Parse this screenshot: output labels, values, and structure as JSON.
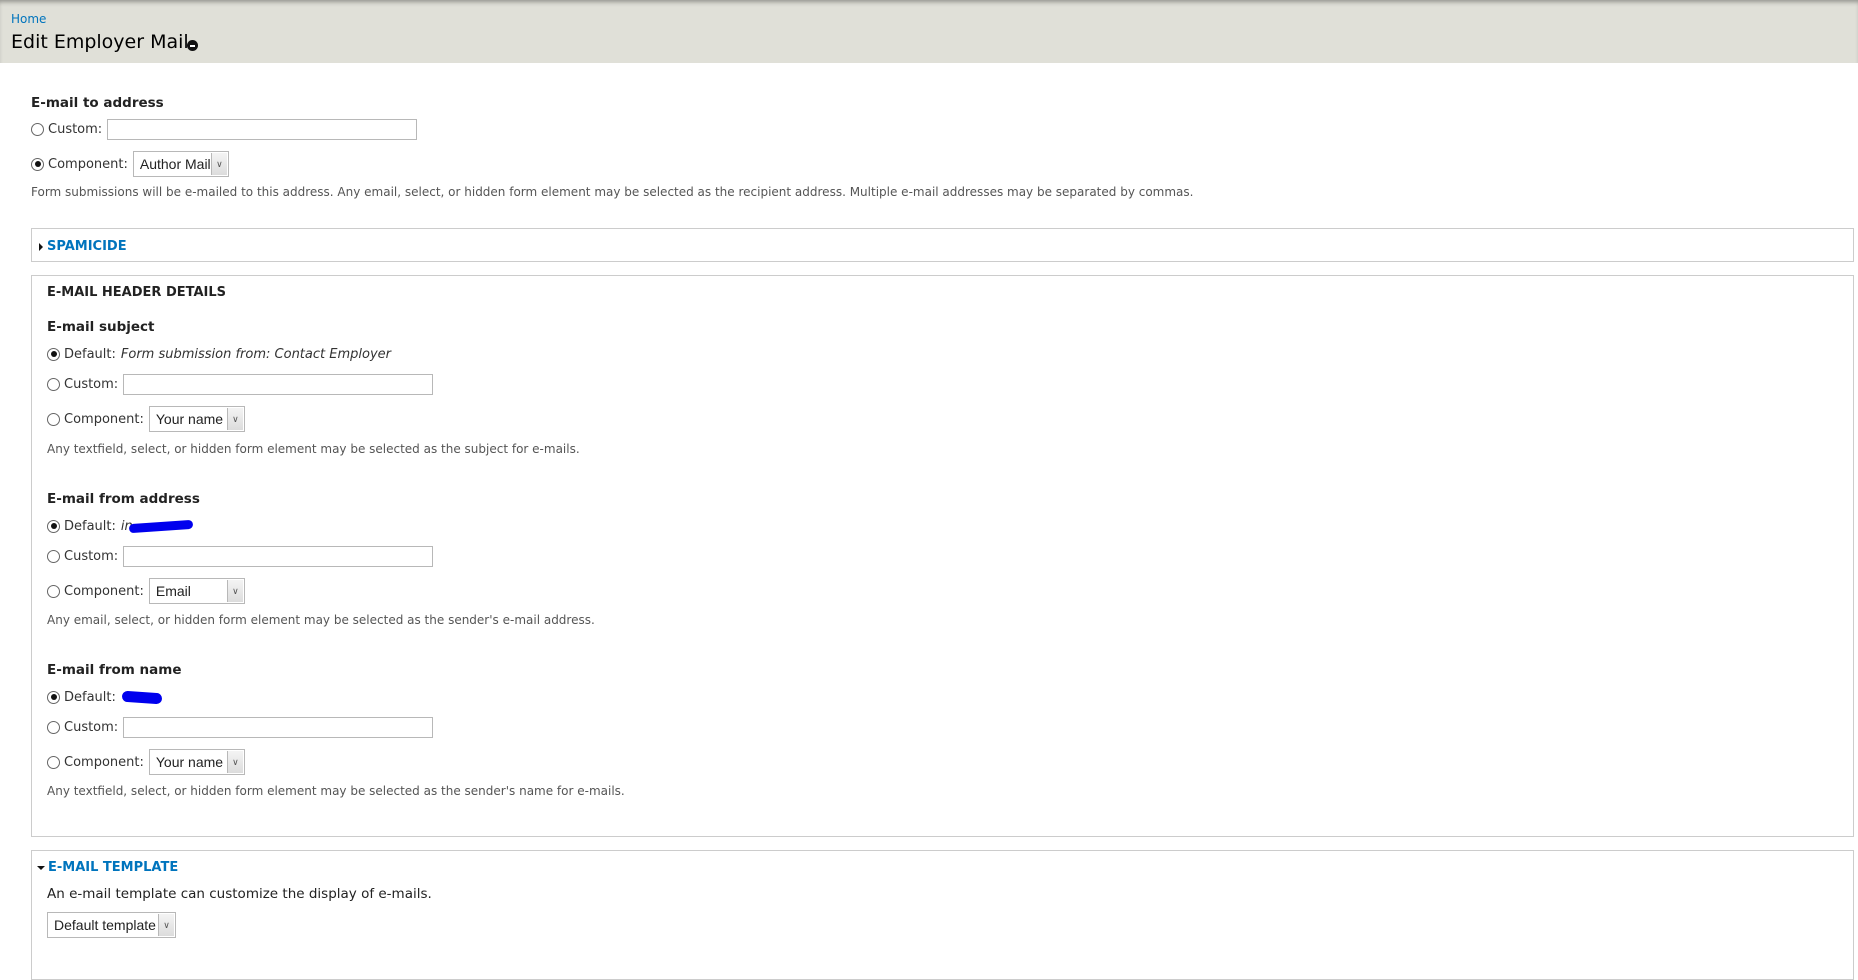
{
  "header": {
    "breadcrumb": "Home",
    "title": "Edit Employer Mail",
    "title_icon": "collapse-minus-icon"
  },
  "to_address": {
    "heading": "E-mail to address",
    "custom_label": "Custom:",
    "custom_value": "",
    "component_label": "Component:",
    "component_value": "Author Mail",
    "selected": "component",
    "description": "Form submissions will be e-mailed to this address. Any email, select, or hidden form element may be selected as the recipient address. Multiple e-mail addresses may be separated by commas."
  },
  "spamicide": {
    "legend": "SPAMICIDE",
    "collapsed": true
  },
  "header_details": {
    "legend": "E-MAIL HEADER DETAILS",
    "subject": {
      "heading": "E-mail subject",
      "default_label": "Default:",
      "default_value": "Form submission from: Contact Employer",
      "custom_label": "Custom:",
      "custom_value": "",
      "component_label": "Component:",
      "component_value": "Your name",
      "selected": "default",
      "description": "Any textfield, select, or hidden form element may be selected as the subject for e-mails."
    },
    "from_address": {
      "heading": "E-mail from address",
      "default_label": "Default:",
      "default_value_visible": "in",
      "default_value_redacted": true,
      "custom_label": "Custom:",
      "custom_value": "",
      "component_label": "Component:",
      "component_value": "Email",
      "selected": "default",
      "description": "Any email, select, or hidden form element may be selected as the sender's e-mail address."
    },
    "from_name": {
      "heading": "E-mail from name",
      "default_label": "Default:",
      "default_value_redacted": true,
      "custom_label": "Custom:",
      "custom_value": "",
      "component_label": "Component:",
      "component_value": "Your name",
      "selected": "default",
      "description": "Any textfield, select, or hidden form element may be selected as the sender's name for e-mails."
    }
  },
  "template": {
    "legend": "E-MAIL TEMPLATE",
    "collapsed": false,
    "description": "An e-mail template can customize the display of e-mails.",
    "select_value": "Default template"
  },
  "colors": {
    "link": "#0074bd",
    "header_bg": "#e0e0d8",
    "redaction": "#0000ee"
  }
}
